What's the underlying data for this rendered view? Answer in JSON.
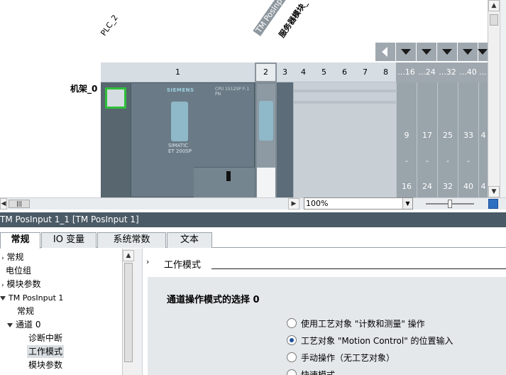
{
  "device_view": {
    "station_labels": [
      "PLC_2",
      "TM PosInput",
      "服务器模块_"
    ],
    "rack_label": "机架_0",
    "slots": [
      "1",
      "2",
      "3",
      "4",
      "5",
      "6",
      "7",
      "8",
      "...16",
      "...24",
      "...32",
      "...40",
      "..."
    ],
    "cpu_brand": "SIEMENS",
    "cpu_model_line1": "SIMATIC",
    "cpu_model_line2": "ET 200SP",
    "cpu_header": "CPU 1512SP F-1 PN",
    "io_column_numbers": [
      {
        "top": "9",
        "mid": "-",
        "bottom": "16"
      },
      {
        "top": "17",
        "mid": "-",
        "bottom": "24"
      },
      {
        "top": "25",
        "mid": "-",
        "bottom": "32"
      },
      {
        "top": "33",
        "mid": "-",
        "bottom": "40"
      },
      {
        "top": "4",
        "mid": "",
        "bottom": "4"
      }
    ]
  },
  "toolbar": {
    "zoom_value": "100%"
  },
  "inspector": {
    "title": "TM PosInput 1_1 [TM PosInput 1]",
    "tabs": [
      "常规",
      "IO 变量",
      "系统常数",
      "文本"
    ],
    "tree": [
      "常规",
      "电位组",
      "模块参数",
      "TM PosInput 1",
      "常规",
      "通道 0",
      "诊断中断",
      "工作模式",
      "模块参数"
    ],
    "section_title": "工作模式",
    "group_title": "通道操作模式的选择 0",
    "radio_options": [
      "使用工艺对象 \"计数和测量\" 操作",
      "工艺对象 \"Motion Control\" 的位置输入",
      "手动操作（无工艺对象）",
      "快速模式"
    ],
    "selected_option_index": 1
  },
  "colors": {
    "rack_bg": "#5c6d79",
    "title_bar": "#4a5a66",
    "port_highlight": "#2fbf3a",
    "panel_bg": "#e4e8eb"
  }
}
